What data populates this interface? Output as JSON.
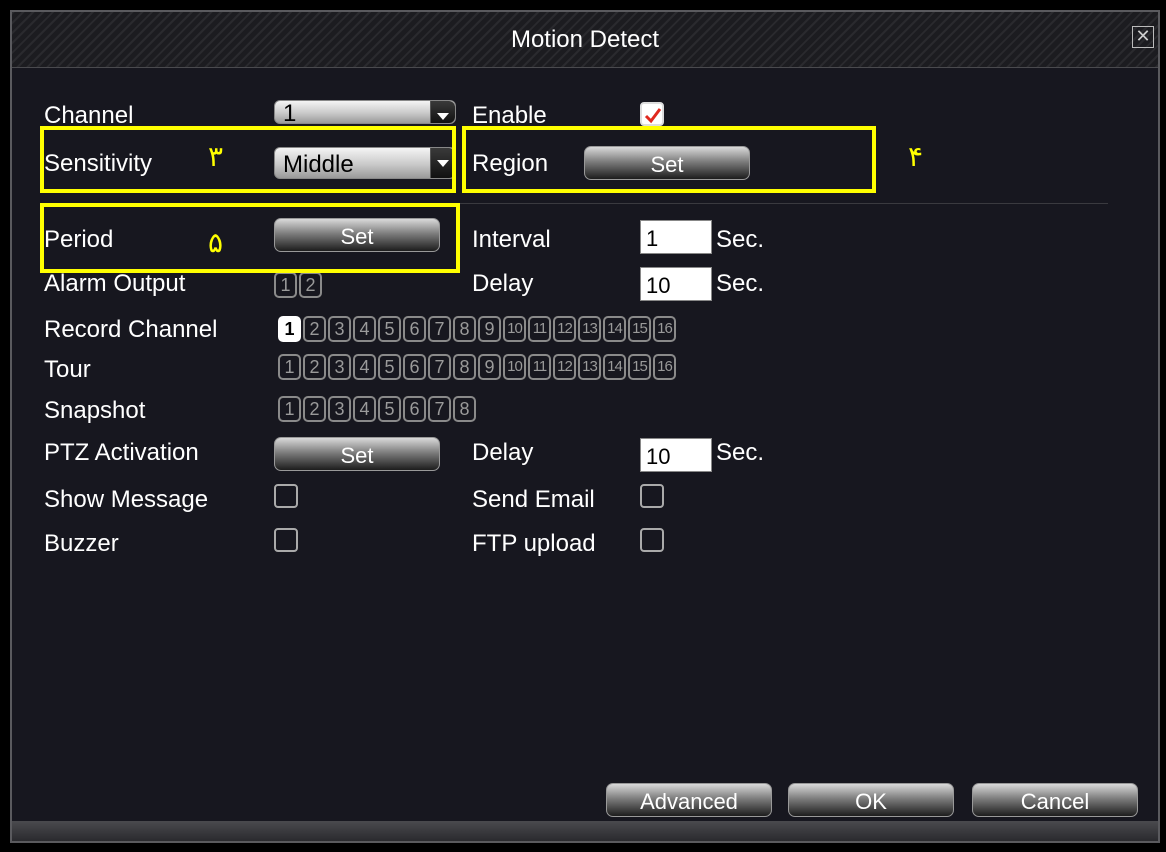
{
  "window": {
    "title": "Motion Detect",
    "close_icon": "close-icon"
  },
  "form": {
    "channel_label": "Channel",
    "channel_value": "1",
    "enable_label": "Enable",
    "enable_checked": true,
    "sensitivity_label": "Sensitivity",
    "sensitivity_value": "Middle",
    "region_label": "Region",
    "region_button": "Set",
    "period_label": "Period",
    "period_button": "Set",
    "interval_label": "Interval",
    "interval_value": "1",
    "interval_unit": "Sec.",
    "alarm_output_label": "Alarm Output",
    "alarm_output_options": [
      "1",
      "2"
    ],
    "delay_label": "Delay",
    "delay_value": "10",
    "delay_unit": "Sec.",
    "record_channel_label": "Record Channel",
    "record_channel_options": [
      "1",
      "2",
      "3",
      "4",
      "5",
      "6",
      "7",
      "8",
      "9",
      "10",
      "11",
      "12",
      "13",
      "14",
      "15",
      "16"
    ],
    "record_channel_selected": [
      "1"
    ],
    "tour_label": "Tour",
    "tour_options": [
      "1",
      "2",
      "3",
      "4",
      "5",
      "6",
      "7",
      "8",
      "9",
      "10",
      "11",
      "12",
      "13",
      "14",
      "15",
      "16"
    ],
    "snapshot_label": "Snapshot",
    "snapshot_options": [
      "1",
      "2",
      "3",
      "4",
      "5",
      "6",
      "7",
      "8"
    ],
    "ptz_label": "PTZ Activation",
    "ptz_button": "Set",
    "ptz_delay_label": "Delay",
    "ptz_delay_value": "10",
    "ptz_delay_unit": "Sec.",
    "show_message_label": "Show Message",
    "show_message_checked": false,
    "send_email_label": "Send Email",
    "send_email_checked": false,
    "buzzer_label": "Buzzer",
    "buzzer_checked": false,
    "ftp_upload_label": "FTP upload",
    "ftp_upload_checked": false
  },
  "footer": {
    "advanced": "Advanced",
    "ok": "OK",
    "cancel": "Cancel"
  },
  "annotations": {
    "sensitivity_num": "٣",
    "region_num": "۴",
    "period_num": "۵",
    "color": "#ffff00"
  }
}
